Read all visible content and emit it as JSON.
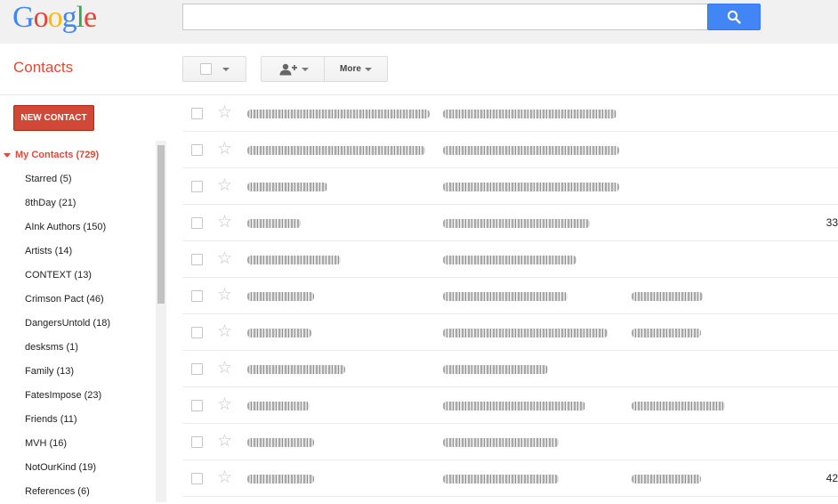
{
  "header": {
    "logo_letters": [
      {
        "ch": "G",
        "color": "#4285f4"
      },
      {
        "ch": "o",
        "color": "#ea4335"
      },
      {
        "ch": "o",
        "color": "#fbbc05"
      },
      {
        "ch": "g",
        "color": "#4285f4"
      },
      {
        "ch": "l",
        "color": "#34a853"
      },
      {
        "ch": "e",
        "color": "#ea4335"
      }
    ],
    "search_value": "",
    "search_icon": "search-icon"
  },
  "app": {
    "title": "Contacts",
    "toolbar": {
      "more_label": "More"
    }
  },
  "sidebar": {
    "new_contact_label": "NEW CONTACT",
    "group_label": "My Contacts (729)",
    "items": [
      {
        "label": "Starred (5)"
      },
      {
        "label": "8thDay (21)"
      },
      {
        "label": "AInk Authors (150)"
      },
      {
        "label": "Artists (14)"
      },
      {
        "label": "CONTEXT (13)"
      },
      {
        "label": "Crimson Pact (46)"
      },
      {
        "label": "DangersUntold (18)"
      },
      {
        "label": "desksms (1)"
      },
      {
        "label": "Family (13)"
      },
      {
        "label": "FatesImpose (23)"
      },
      {
        "label": "Friends (11)"
      },
      {
        "label": "MVH (16)"
      },
      {
        "label": "NotOurKind (19)"
      },
      {
        "label": "References (6)"
      }
    ]
  },
  "contacts": [
    {
      "tail": ""
    },
    {
      "tail": ""
    },
    {
      "tail": ""
    },
    {
      "tail": "33"
    },
    {
      "tail": ""
    },
    {
      "tail": ""
    },
    {
      "tail": ""
    },
    {
      "tail": ""
    },
    {
      "tail": ""
    },
    {
      "tail": ""
    },
    {
      "tail": "42"
    }
  ],
  "colors": {
    "accent_red": "#dd4b39",
    "button_red": "#d14836",
    "search_blue": "#4285f4"
  }
}
